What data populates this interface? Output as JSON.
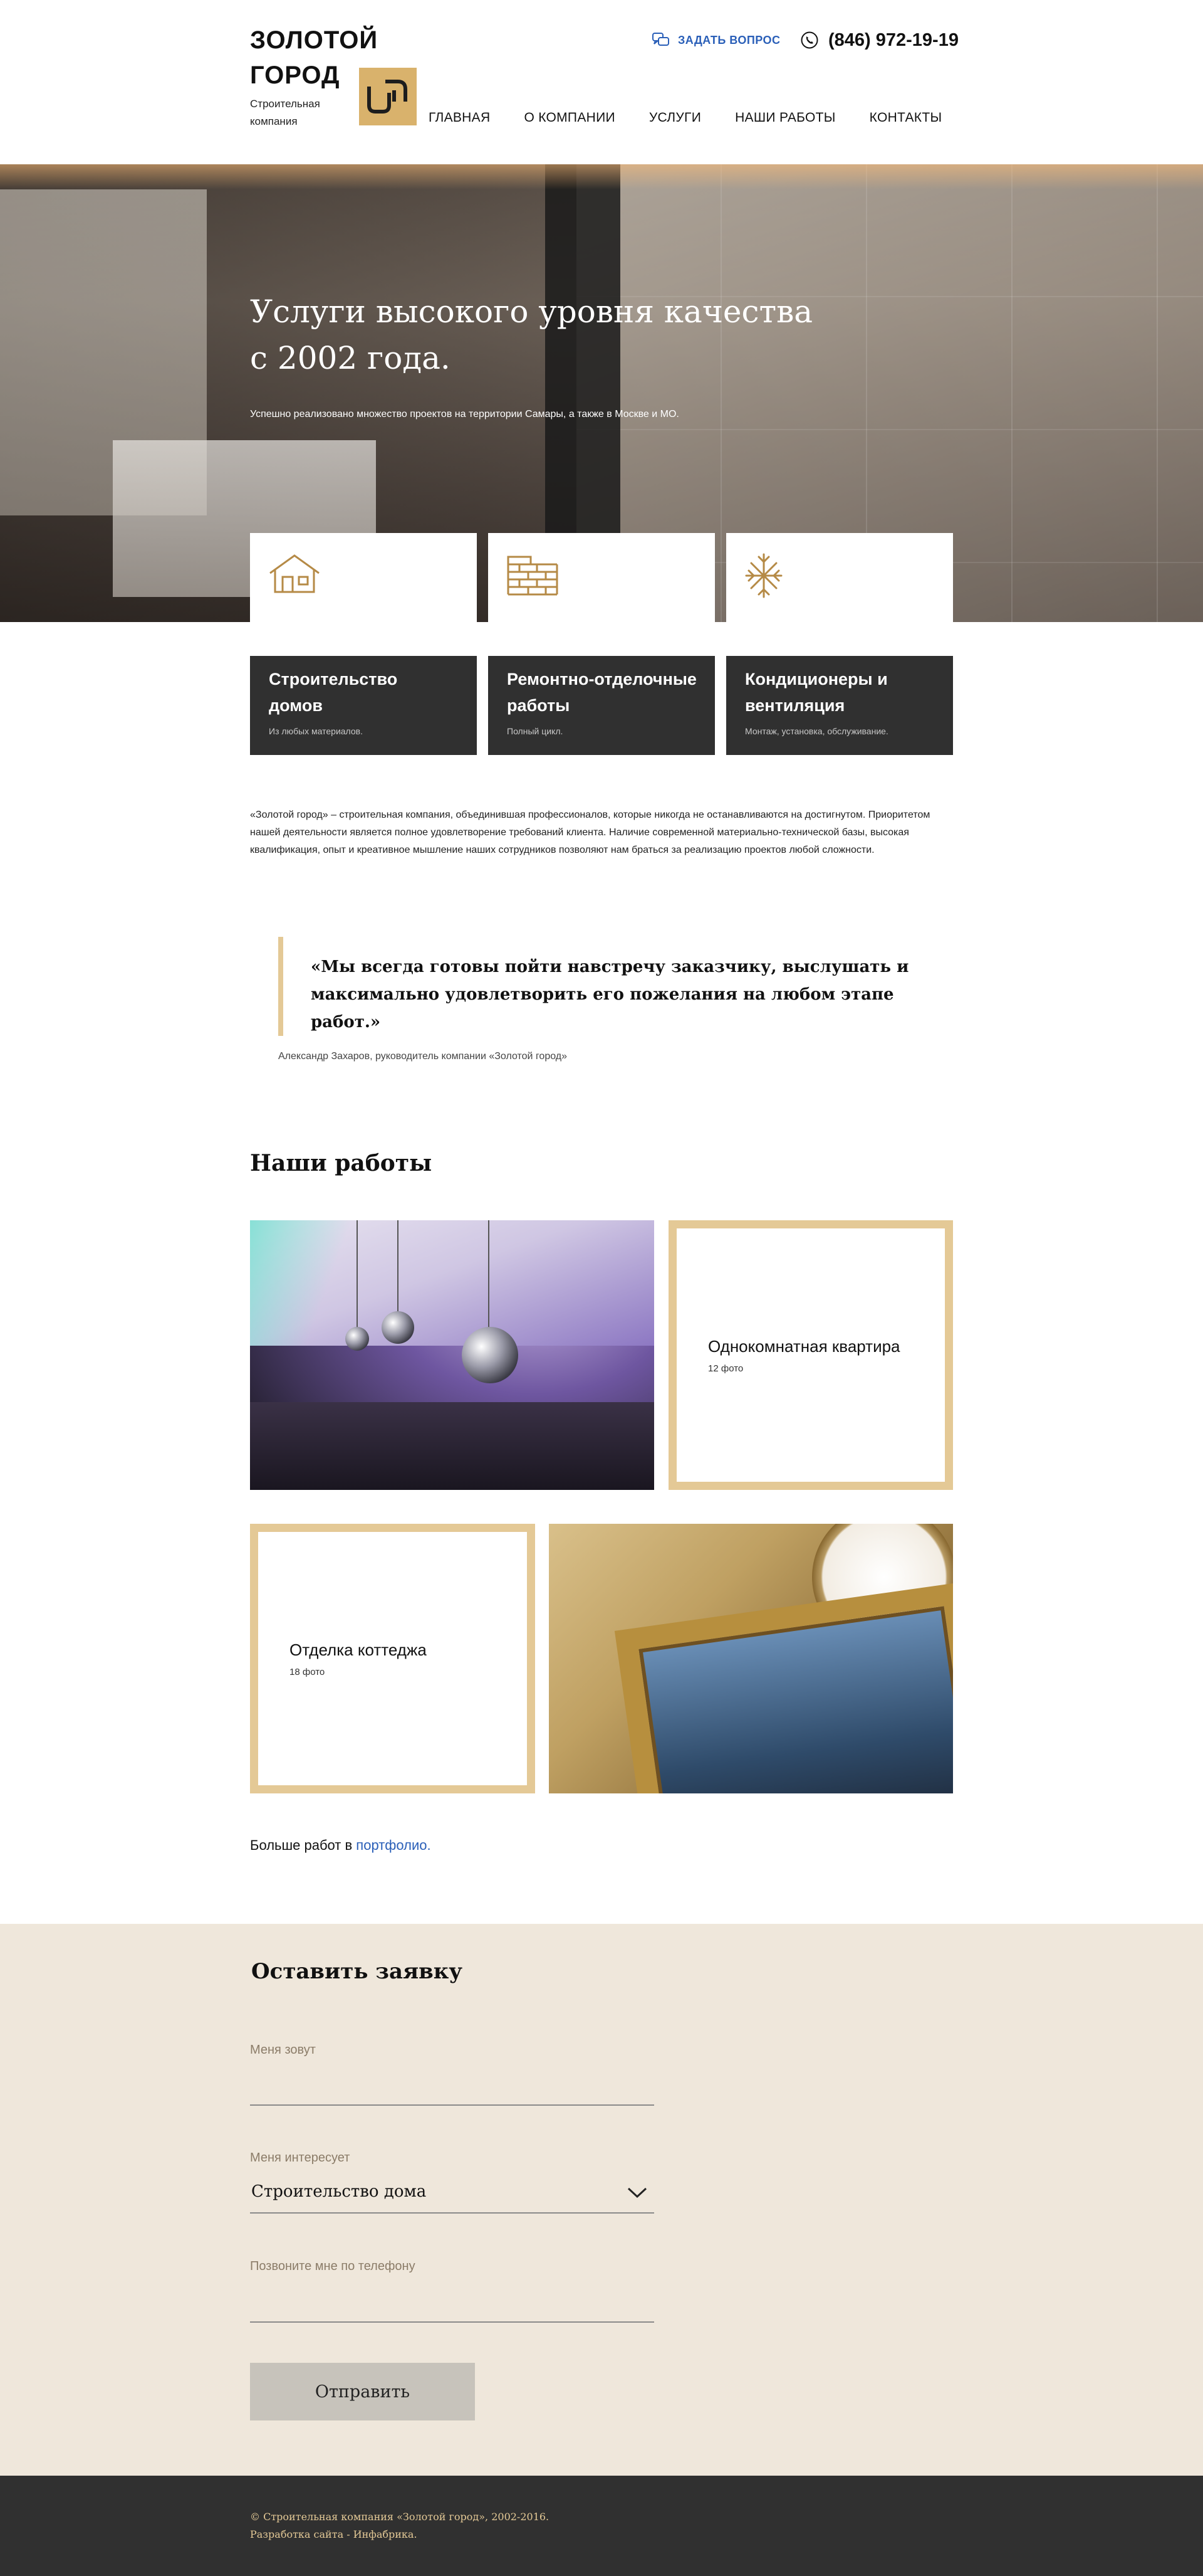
{
  "header": {
    "brand_name": "ЗОЛОТОЙ ГОРОД",
    "brand_sub": "Строительная компания",
    "ask_label": "ЗАДАТЬ ВОПРОС",
    "phone": "(846) 972-19-19",
    "nav": [
      "ГЛАВНАЯ",
      "О КОМПАНИИ",
      "УСЛУГИ",
      "НАШИ РАБОТЫ",
      "КОНТАКТЫ"
    ],
    "accent_color": "#d9b26c"
  },
  "hero": {
    "title": "Услуги высокого уровня качества с 2002 года.",
    "subtitle": "Успешно реализовано множество проектов на территории Самары, а также в Москве и МО."
  },
  "services": [
    {
      "icon": "house-icon",
      "title": "Строительство домов",
      "desc": "Из любых материалов."
    },
    {
      "icon": "brick-wall-icon",
      "title": "Ремонтно-отделочные работы",
      "desc": "Полный цикл."
    },
    {
      "icon": "snowflake-icon",
      "title": "Кондиционеры и вентиляция",
      "desc": "Монтаж, установка, обслуживание."
    }
  ],
  "about": "«Золотой город» – строительная компания, объединившая профессионалов, которые никогда не останавливаются на достигнутом. Приоритетом нашей деятельности является полное удовлетворение требований клиента. Наличие современной материально-технической базы, высокая квалификация, опыт и креативное мышление наших сотрудников позволяют нам браться за реализацию проектов любой сложности.",
  "quote": {
    "text": "«Мы всегда готовы пойти навстречу заказчику, выслушать и максимально удовлетворить его пожелания на любом этапе работ.»",
    "author": "Александр Захаров, руководитель компании «Золотой город»"
  },
  "works": {
    "title": "Наши работы",
    "items": [
      {
        "title": "Однокомнатная квартира",
        "count": "12 фото"
      },
      {
        "title": "Отделка коттеджа",
        "count": "18 фото"
      }
    ],
    "more_prefix": "Больше работ в ",
    "more_link": "портфолио."
  },
  "form": {
    "title": "Оставить заявку",
    "name_label": "Меня зовут",
    "interest_label": "Меня интересует",
    "interest_value": "Строительство дома",
    "phone_label": "Позвоните мне по телефону",
    "submit_label": "Отправить"
  },
  "footer": {
    "line1": "© Строительная компания «Золотой город», 2002-2016.",
    "line2": "Разработка сайта - Инфабрика."
  }
}
